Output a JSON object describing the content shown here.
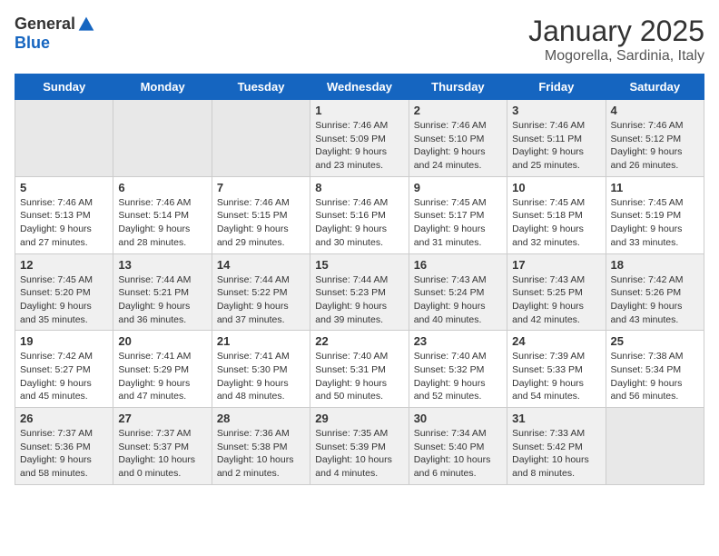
{
  "header": {
    "logo_general": "General",
    "logo_blue": "Blue",
    "title": "January 2025",
    "subtitle": "Mogorella, Sardinia, Italy"
  },
  "weekdays": [
    "Sunday",
    "Monday",
    "Tuesday",
    "Wednesday",
    "Thursday",
    "Friday",
    "Saturday"
  ],
  "weeks": [
    [
      {
        "day": "",
        "info": ""
      },
      {
        "day": "",
        "info": ""
      },
      {
        "day": "",
        "info": ""
      },
      {
        "day": "1",
        "info": "Sunrise: 7:46 AM\nSunset: 5:09 PM\nDaylight: 9 hours\nand 23 minutes."
      },
      {
        "day": "2",
        "info": "Sunrise: 7:46 AM\nSunset: 5:10 PM\nDaylight: 9 hours\nand 24 minutes."
      },
      {
        "day": "3",
        "info": "Sunrise: 7:46 AM\nSunset: 5:11 PM\nDaylight: 9 hours\nand 25 minutes."
      },
      {
        "day": "4",
        "info": "Sunrise: 7:46 AM\nSunset: 5:12 PM\nDaylight: 9 hours\nand 26 minutes."
      }
    ],
    [
      {
        "day": "5",
        "info": "Sunrise: 7:46 AM\nSunset: 5:13 PM\nDaylight: 9 hours\nand 27 minutes."
      },
      {
        "day": "6",
        "info": "Sunrise: 7:46 AM\nSunset: 5:14 PM\nDaylight: 9 hours\nand 28 minutes."
      },
      {
        "day": "7",
        "info": "Sunrise: 7:46 AM\nSunset: 5:15 PM\nDaylight: 9 hours\nand 29 minutes."
      },
      {
        "day": "8",
        "info": "Sunrise: 7:46 AM\nSunset: 5:16 PM\nDaylight: 9 hours\nand 30 minutes."
      },
      {
        "day": "9",
        "info": "Sunrise: 7:45 AM\nSunset: 5:17 PM\nDaylight: 9 hours\nand 31 minutes."
      },
      {
        "day": "10",
        "info": "Sunrise: 7:45 AM\nSunset: 5:18 PM\nDaylight: 9 hours\nand 32 minutes."
      },
      {
        "day": "11",
        "info": "Sunrise: 7:45 AM\nSunset: 5:19 PM\nDaylight: 9 hours\nand 33 minutes."
      }
    ],
    [
      {
        "day": "12",
        "info": "Sunrise: 7:45 AM\nSunset: 5:20 PM\nDaylight: 9 hours\nand 35 minutes."
      },
      {
        "day": "13",
        "info": "Sunrise: 7:44 AM\nSunset: 5:21 PM\nDaylight: 9 hours\nand 36 minutes."
      },
      {
        "day": "14",
        "info": "Sunrise: 7:44 AM\nSunset: 5:22 PM\nDaylight: 9 hours\nand 37 minutes."
      },
      {
        "day": "15",
        "info": "Sunrise: 7:44 AM\nSunset: 5:23 PM\nDaylight: 9 hours\nand 39 minutes."
      },
      {
        "day": "16",
        "info": "Sunrise: 7:43 AM\nSunset: 5:24 PM\nDaylight: 9 hours\nand 40 minutes."
      },
      {
        "day": "17",
        "info": "Sunrise: 7:43 AM\nSunset: 5:25 PM\nDaylight: 9 hours\nand 42 minutes."
      },
      {
        "day": "18",
        "info": "Sunrise: 7:42 AM\nSunset: 5:26 PM\nDaylight: 9 hours\nand 43 minutes."
      }
    ],
    [
      {
        "day": "19",
        "info": "Sunrise: 7:42 AM\nSunset: 5:27 PM\nDaylight: 9 hours\nand 45 minutes."
      },
      {
        "day": "20",
        "info": "Sunrise: 7:41 AM\nSunset: 5:29 PM\nDaylight: 9 hours\nand 47 minutes."
      },
      {
        "day": "21",
        "info": "Sunrise: 7:41 AM\nSunset: 5:30 PM\nDaylight: 9 hours\nand 48 minutes."
      },
      {
        "day": "22",
        "info": "Sunrise: 7:40 AM\nSunset: 5:31 PM\nDaylight: 9 hours\nand 50 minutes."
      },
      {
        "day": "23",
        "info": "Sunrise: 7:40 AM\nSunset: 5:32 PM\nDaylight: 9 hours\nand 52 minutes."
      },
      {
        "day": "24",
        "info": "Sunrise: 7:39 AM\nSunset: 5:33 PM\nDaylight: 9 hours\nand 54 minutes."
      },
      {
        "day": "25",
        "info": "Sunrise: 7:38 AM\nSunset: 5:34 PM\nDaylight: 9 hours\nand 56 minutes."
      }
    ],
    [
      {
        "day": "26",
        "info": "Sunrise: 7:37 AM\nSunset: 5:36 PM\nDaylight: 9 hours\nand 58 minutes."
      },
      {
        "day": "27",
        "info": "Sunrise: 7:37 AM\nSunset: 5:37 PM\nDaylight: 10 hours\nand 0 minutes."
      },
      {
        "day": "28",
        "info": "Sunrise: 7:36 AM\nSunset: 5:38 PM\nDaylight: 10 hours\nand 2 minutes."
      },
      {
        "day": "29",
        "info": "Sunrise: 7:35 AM\nSunset: 5:39 PM\nDaylight: 10 hours\nand 4 minutes."
      },
      {
        "day": "30",
        "info": "Sunrise: 7:34 AM\nSunset: 5:40 PM\nDaylight: 10 hours\nand 6 minutes."
      },
      {
        "day": "31",
        "info": "Sunrise: 7:33 AM\nSunset: 5:42 PM\nDaylight: 10 hours\nand 8 minutes."
      },
      {
        "day": "",
        "info": ""
      }
    ]
  ]
}
